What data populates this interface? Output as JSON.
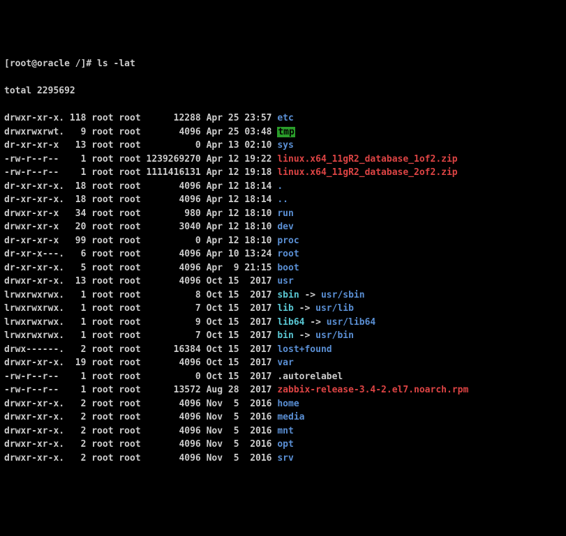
{
  "prompt": "[root@oracle /]# ls -lat",
  "total": "total 2295692",
  "rows": [
    {
      "perm": "drwxr-xr-x.",
      "links": "118",
      "owner": "root",
      "group": "root",
      "size": "12288",
      "mon": "Apr",
      "day": "25",
      "time": "23:57",
      "name": "etc",
      "class": "blue"
    },
    {
      "perm": "drwxrwxrwt.",
      "links": "9",
      "owner": "root",
      "group": "root",
      "size": "4096",
      "mon": "Apr",
      "day": "25",
      "time": "03:48",
      "name": "tmp",
      "class": "tmp"
    },
    {
      "perm": "dr-xr-xr-x",
      "links": "13",
      "owner": "root",
      "group": "root",
      "size": "0",
      "mon": "Apr",
      "day": "13",
      "time": "02:10",
      "name": "sys",
      "class": "blue"
    },
    {
      "perm": "-rw-r--r--",
      "links": "1",
      "owner": "root",
      "group": "root",
      "size": "1239269270",
      "mon": "Apr",
      "day": "12",
      "time": "19:22",
      "name": "linux.x64_11gR2_database_1of2.zip",
      "class": "red"
    },
    {
      "perm": "-rw-r--r--",
      "links": "1",
      "owner": "root",
      "group": "root",
      "size": "1111416131",
      "mon": "Apr",
      "day": "12",
      "time": "19:18",
      "name": "linux.x64_11gR2_database_2of2.zip",
      "class": "red"
    },
    {
      "perm": "dr-xr-xr-x.",
      "links": "18",
      "owner": "root",
      "group": "root",
      "size": "4096",
      "mon": "Apr",
      "day": "12",
      "time": "18:14",
      "name": ".",
      "class": "blue"
    },
    {
      "perm": "dr-xr-xr-x.",
      "links": "18",
      "owner": "root",
      "group": "root",
      "size": "4096",
      "mon": "Apr",
      "day": "12",
      "time": "18:14",
      "name": "..",
      "class": "blue"
    },
    {
      "perm": "drwxr-xr-x",
      "links": "34",
      "owner": "root",
      "group": "root",
      "size": "980",
      "mon": "Apr",
      "day": "12",
      "time": "18:10",
      "name": "run",
      "class": "blue"
    },
    {
      "perm": "drwxr-xr-x",
      "links": "20",
      "owner": "root",
      "group": "root",
      "size": "3040",
      "mon": "Apr",
      "day": "12",
      "time": "18:10",
      "name": "dev",
      "class": "blue"
    },
    {
      "perm": "dr-xr-xr-x",
      "links": "99",
      "owner": "root",
      "group": "root",
      "size": "0",
      "mon": "Apr",
      "day": "12",
      "time": "18:10",
      "name": "proc",
      "class": "blue"
    },
    {
      "perm": "dr-xr-x---.",
      "links": "6",
      "owner": "root",
      "group": "root",
      "size": "4096",
      "mon": "Apr",
      "day": "10",
      "time": "13:24",
      "name": "root",
      "class": "blue"
    },
    {
      "perm": "dr-xr-xr-x.",
      "links": "5",
      "owner": "root",
      "group": "root",
      "size": "4096",
      "mon": "Apr",
      "day": " 9",
      "time": "21:15",
      "name": "boot",
      "class": "blue"
    },
    {
      "perm": "drwxr-xr-x.",
      "links": "13",
      "owner": "root",
      "group": "root",
      "size": "4096",
      "mon": "Oct",
      "day": "15",
      "time": " 2017",
      "name": "usr",
      "class": "blue"
    },
    {
      "perm": "lrwxrwxrwx.",
      "links": "1",
      "owner": "root",
      "group": "root",
      "size": "8",
      "mon": "Oct",
      "day": "15",
      "time": " 2017",
      "name": "sbin",
      "class": "cyan",
      "arrow": " -> ",
      "target": "usr/sbin",
      "tclass": "blue"
    },
    {
      "perm": "lrwxrwxrwx.",
      "links": "1",
      "owner": "root",
      "group": "root",
      "size": "7",
      "mon": "Oct",
      "day": "15",
      "time": " 2017",
      "name": "lib",
      "class": "cyan",
      "arrow": " -> ",
      "target": "usr/lib",
      "tclass": "blue"
    },
    {
      "perm": "lrwxrwxrwx.",
      "links": "1",
      "owner": "root",
      "group": "root",
      "size": "9",
      "mon": "Oct",
      "day": "15",
      "time": " 2017",
      "name": "lib64",
      "class": "cyan",
      "arrow": " -> ",
      "target": "usr/lib64",
      "tclass": "blue"
    },
    {
      "perm": "lrwxrwxrwx.",
      "links": "1",
      "owner": "root",
      "group": "root",
      "size": "7",
      "mon": "Oct",
      "day": "15",
      "time": " 2017",
      "name": "bin",
      "class": "cyan",
      "arrow": " -> ",
      "target": "usr/bin",
      "tclass": "blue"
    },
    {
      "perm": "drwx------.",
      "links": "2",
      "owner": "root",
      "group": "root",
      "size": "16384",
      "mon": "Oct",
      "day": "15",
      "time": " 2017",
      "name": "lost+found",
      "class": "blue"
    },
    {
      "perm": "drwxr-xr-x.",
      "links": "19",
      "owner": "root",
      "group": "root",
      "size": "4096",
      "mon": "Oct",
      "day": "15",
      "time": " 2017",
      "name": "var",
      "class": "blue"
    },
    {
      "perm": "-rw-r--r--",
      "links": "1",
      "owner": "root",
      "group": "root",
      "size": "0",
      "mon": "Oct",
      "day": "15",
      "time": " 2017",
      "name": ".autorelabel",
      "class": "plain"
    },
    {
      "perm": "-rw-r--r--",
      "links": "1",
      "owner": "root",
      "group": "root",
      "size": "13572",
      "mon": "Aug",
      "day": "28",
      "time": " 2017",
      "name": "zabbix-release-3.4-2.el7.noarch.rpm",
      "class": "red"
    },
    {
      "perm": "drwxr-xr-x.",
      "links": "2",
      "owner": "root",
      "group": "root",
      "size": "4096",
      "mon": "Nov",
      "day": " 5",
      "time": " 2016",
      "name": "home",
      "class": "blue"
    },
    {
      "perm": "drwxr-xr-x.",
      "links": "2",
      "owner": "root",
      "group": "root",
      "size": "4096",
      "mon": "Nov",
      "day": " 5",
      "time": " 2016",
      "name": "media",
      "class": "blue"
    },
    {
      "perm": "drwxr-xr-x.",
      "links": "2",
      "owner": "root",
      "group": "root",
      "size": "4096",
      "mon": "Nov",
      "day": " 5",
      "time": " 2016",
      "name": "mnt",
      "class": "blue"
    },
    {
      "perm": "drwxr-xr-x.",
      "links": "2",
      "owner": "root",
      "group": "root",
      "size": "4096",
      "mon": "Nov",
      "day": " 5",
      "time": " 2016",
      "name": "opt",
      "class": "blue"
    },
    {
      "perm": "drwxr-xr-x.",
      "links": "2",
      "owner": "root",
      "group": "root",
      "size": "4096",
      "mon": "Nov",
      "day": " 5",
      "time": " 2016",
      "name": "srv",
      "class": "blue"
    }
  ]
}
